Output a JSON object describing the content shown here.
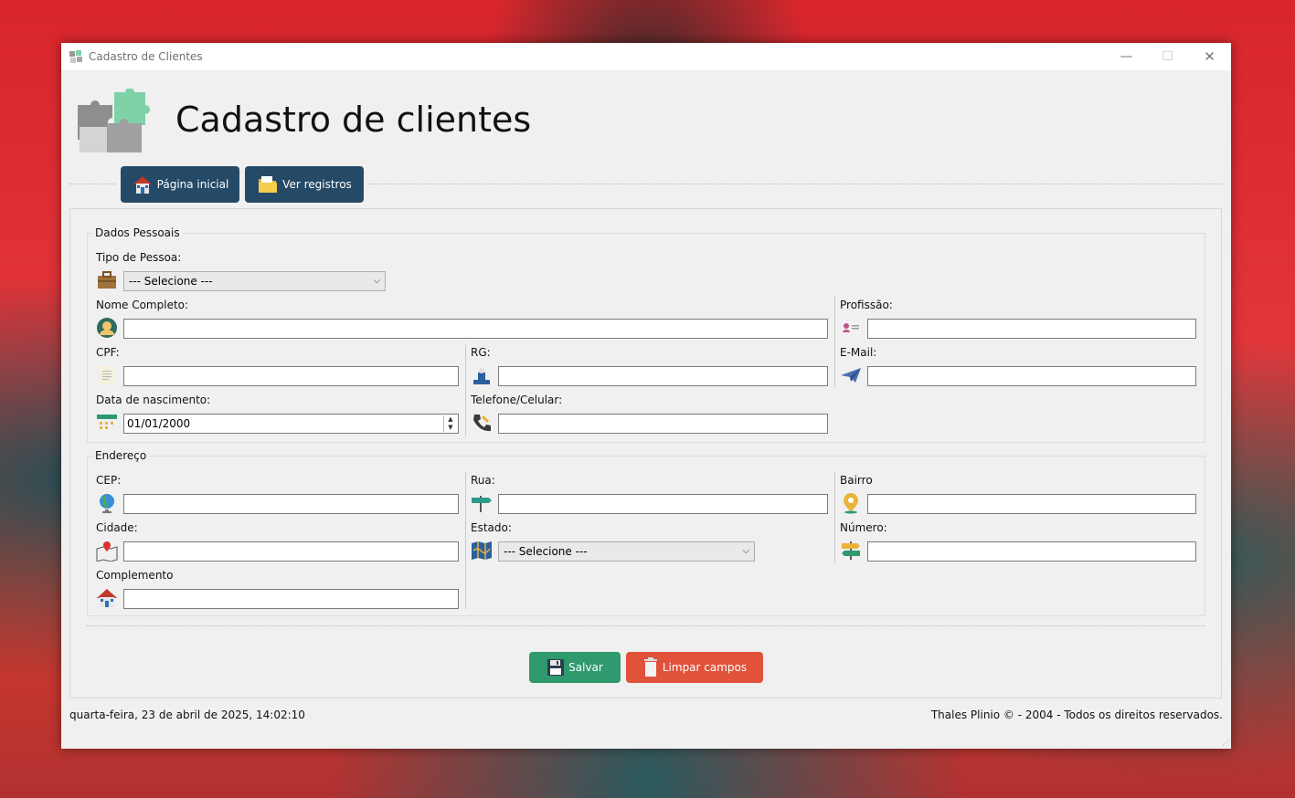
{
  "window": {
    "title": "Cadastro de Clientes",
    "controls": {
      "minimize": "—",
      "maximize": "☐",
      "close": "✕"
    }
  },
  "header": {
    "title": "Cadastro de clientes"
  },
  "nav": {
    "home_label": "Página inicial",
    "records_label": "Ver registros"
  },
  "personal": {
    "legend": "Dados Pessoais",
    "tipo_label": "Tipo de Pessoa:",
    "tipo_value": "--- Selecione ---",
    "nome_label": "Nome Completo:",
    "nome_value": "",
    "profissao_label": "Profissão:",
    "profissao_value": "",
    "cpf_label": "CPF:",
    "cpf_value": "",
    "rg_label": "RG:",
    "rg_value": "",
    "email_label": "E-Mail:",
    "email_value": "",
    "nasc_label": "Data de nascimento:",
    "nasc_value": "01/01/2000",
    "telefone_label": "Telefone/Celular:",
    "telefone_value": ""
  },
  "address": {
    "legend": "Endereço",
    "cep_label": "CEP:",
    "cep_value": "",
    "rua_label": "Rua:",
    "rua_value": "",
    "bairro_label": "Bairro",
    "bairro_value": "",
    "cidade_label": "Cidade:",
    "cidade_value": "",
    "estado_label": "Estado:",
    "estado_value": "--- Selecione ---",
    "numero_label": "Número:",
    "numero_value": "",
    "complemento_label": "Complemento",
    "complemento_value": ""
  },
  "actions": {
    "save_label": "Salvar",
    "clear_label": "Limpar campos"
  },
  "status": {
    "datetime": "quarta-feira, 23 de abril de 2025,  14:02:10",
    "copyright": "Thales Plinio © - 2004 - Todos os direitos reservados."
  },
  "colors": {
    "nav_button": "#254a68",
    "save_button": "#2e9a6e",
    "clear_button": "#e0523a"
  }
}
